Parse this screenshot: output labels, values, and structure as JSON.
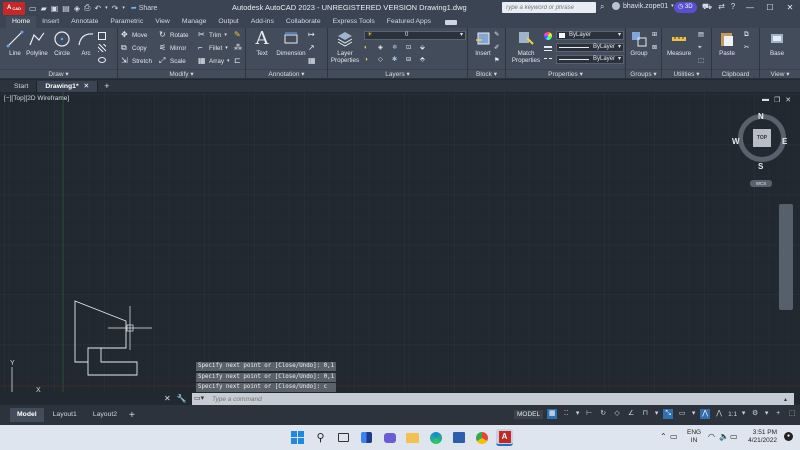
{
  "titlebar": {
    "app_badge": "CAD",
    "share_label": "Share",
    "window_title": "Autodesk AutoCAD 2023 - UNREGISTERED VERSION    Drawing1.dwg",
    "search_placeholder": "Type a keyword or phrase",
    "user_name": "bhavik.zope01",
    "badge_3d": "3D"
  },
  "ribbon_tabs": [
    "Home",
    "Insert",
    "Annotate",
    "Parametric",
    "View",
    "Manage",
    "Output",
    "Add-ins",
    "Collaborate",
    "Express Tools",
    "Featured Apps"
  ],
  "active_ribbon_tab": "Home",
  "panels": {
    "draw": {
      "title": "Draw",
      "tools": [
        "Line",
        "Polyline",
        "Circle",
        "Arc"
      ]
    },
    "modify": {
      "title": "Modify",
      "tools": [
        "Move",
        "Rotate",
        "Trim",
        "Copy",
        "Mirror",
        "Fillet",
        "Stretch",
        "Scale",
        "Array"
      ]
    },
    "annotation": {
      "title": "Annotation",
      "tools": [
        "Text",
        "Dimension"
      ]
    },
    "layers": {
      "title": "Layers",
      "tool": "Layer Properties",
      "layer_value": "0"
    },
    "block": {
      "title": "Block",
      "tool": "Insert"
    },
    "properties": {
      "title": "Properties",
      "tool": "Match Properties",
      "color_value": "ByLayer",
      "linetype_value": "ByLayer",
      "lineweight_value": "ByLayer"
    },
    "groups": {
      "title": "Groups",
      "tool": "Group"
    },
    "utilities": {
      "title": "Utilities",
      "tool": "Measure"
    },
    "clipboard": {
      "title": "Clipboard",
      "tool": "Paste"
    },
    "view": {
      "title": "View",
      "tool": "Base"
    }
  },
  "file_tabs": [
    {
      "label": "Start",
      "active": false
    },
    {
      "label": "Drawing1*",
      "active": true
    }
  ],
  "viewport": {
    "label": "[−][Top][2D Wireframe]",
    "viewcube": {
      "north": "N",
      "south": "S",
      "east": "E",
      "west": "W",
      "face": "TOP",
      "wcs": "WCS"
    },
    "ucs": {
      "x": "X",
      "y": "Y"
    }
  },
  "command": {
    "history": [
      "Specify next point or [Close/Undo]: 0,1",
      "Specify next point or [Close/Undo]: 0,1",
      "Specify next point or [Close/Undo]: c"
    ],
    "placeholder": "Type a command"
  },
  "layout_tabs": [
    {
      "label": "Model",
      "active": true
    },
    {
      "label": "Layout1",
      "active": false
    },
    {
      "label": "Layout2",
      "active": false
    }
  ],
  "status": {
    "model_label": "MODEL",
    "scale": "1:1"
  },
  "taskbar": {
    "language_top": "ENG",
    "language_bottom": "IN",
    "time": "3:51 PM",
    "date": "4/21/2022"
  },
  "colors": {
    "canvas_bg": "#212830",
    "ribbon_bg": "#434c5b",
    "title_bg": "#3b4453",
    "autocad_red": "#c62828",
    "accent_blue": "#2f6fb2"
  }
}
